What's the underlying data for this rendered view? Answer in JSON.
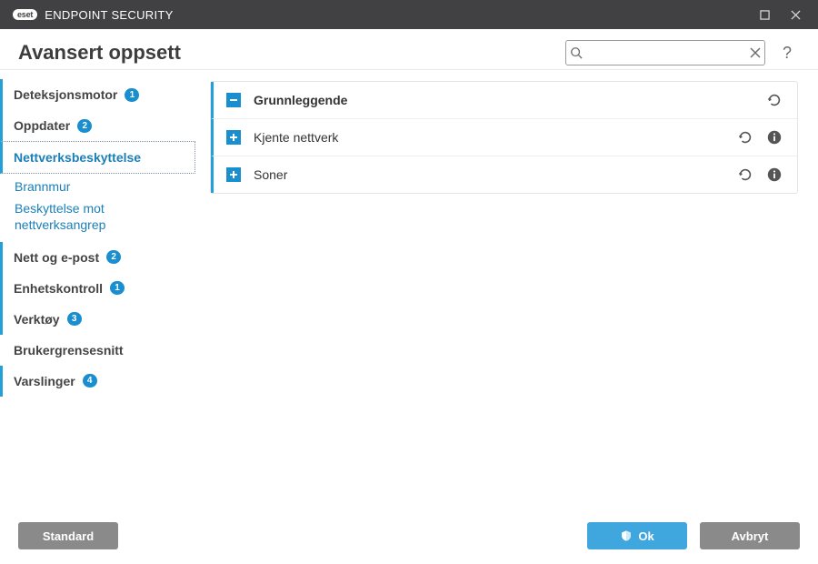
{
  "titlebar": {
    "brand_pill": "eset",
    "brand_name": "ENDPOINT SECURITY"
  },
  "header": {
    "title": "Avansert oppsett",
    "search_placeholder": ""
  },
  "sidebar": {
    "items": [
      {
        "label": "Deteksjonsmotor",
        "badge": "1",
        "border": true
      },
      {
        "label": "Oppdater",
        "badge": "2",
        "border": true
      },
      {
        "label": "Nettverksbeskyttelse",
        "badge": null,
        "active": true,
        "border": true,
        "subitems": [
          {
            "label": "Brannmur"
          },
          {
            "label": "Beskyttelse mot nettverksangrep"
          }
        ]
      },
      {
        "label": "Nett og e-post",
        "badge": "2",
        "border": true
      },
      {
        "label": "Enhetskontroll",
        "badge": "1",
        "border": true
      },
      {
        "label": "Verktøy",
        "badge": "3",
        "border": true
      },
      {
        "label": "Brukergrensesnitt",
        "badge": null,
        "border": false
      },
      {
        "label": "Varslinger",
        "badge": "4",
        "border": true
      }
    ]
  },
  "content": {
    "sections": [
      {
        "label": "Grunnleggende",
        "expanded": true,
        "has_info": false
      },
      {
        "label": "Kjente nettverk",
        "expanded": false,
        "has_info": true
      },
      {
        "label": "Soner",
        "expanded": false,
        "has_info": true
      }
    ]
  },
  "footer": {
    "default_label": "Standard",
    "ok_label": "Ok",
    "cancel_label": "Avbryt"
  }
}
